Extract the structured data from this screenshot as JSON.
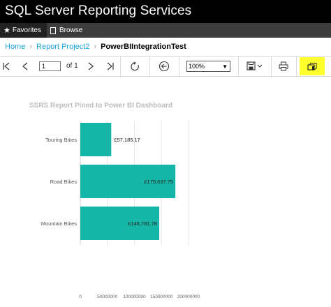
{
  "app": {
    "title": "SQL Server Reporting Services"
  },
  "nav": {
    "favorites": "Favorites",
    "browse": "Browse"
  },
  "breadcrumb": {
    "home": "Home",
    "project": "Report Project2",
    "current": "PowerBIIntegrationTest"
  },
  "toolbar": {
    "page_value": "1",
    "of_label": "of 1",
    "zoom": "100%"
  },
  "chart_data": {
    "type": "bar",
    "orientation": "horizontal",
    "title": "SSRS Report Pined to Power BI Dashboard",
    "categories": [
      "Touring Bikes",
      "Road Bikes",
      "Mountain Bikes"
    ],
    "values": [
      57185.17,
      175637.75,
      145781.78
    ],
    "data_labels": [
      "£57,185.17",
      "£175,637.75",
      "£145,781.78"
    ],
    "xticks": [
      "0",
      "50000000",
      "100000000",
      "150000000",
      "200000000"
    ],
    "xlim": [
      0,
      200000
    ],
    "grid": true,
    "bar_color": "#16b6a6"
  }
}
